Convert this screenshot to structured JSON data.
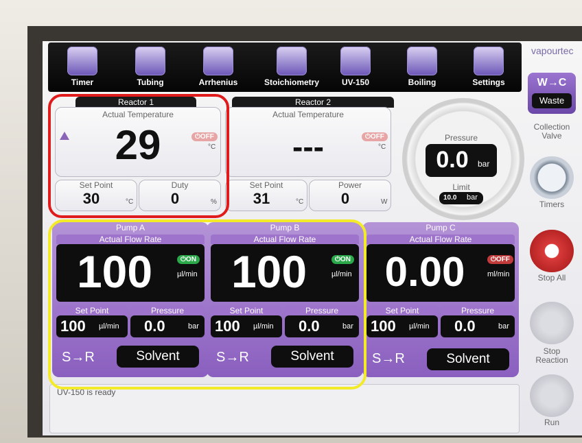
{
  "brand": "vapourtec",
  "toolbar": [
    "Timer",
    "Tubing",
    "Arrhenius",
    "Stoichiometry",
    "UV-150",
    "Boiling",
    "Settings"
  ],
  "reactor1": {
    "title": "Reactor 1",
    "label_actual": "Actual Temperature",
    "value": "29",
    "unit": "°C",
    "status": "OFF",
    "set_point_label": "Set Point",
    "set_point": "30",
    "set_unit": "°C",
    "duty_label": "Duty",
    "duty": "0",
    "duty_unit": "%"
  },
  "reactor2": {
    "title": "Reactor 2",
    "label_actual": "Actual Temperature",
    "value": "---",
    "unit": "°C",
    "status": "OFF",
    "set_point_label": "Set Point",
    "set_point": "31",
    "set_unit": "°C",
    "power_label": "Power",
    "power": "0",
    "power_unit": "W"
  },
  "pressure": {
    "label": "Pressure",
    "value": "0.0",
    "unit": "bar",
    "limit_label": "Limit",
    "limit": "10.0",
    "limit_unit": "bar"
  },
  "pumps": [
    {
      "title": "Pump A",
      "afr": "Actual Flow Rate",
      "value": "100",
      "unit": "µl/min",
      "status": "ON",
      "sp_label": "Set Point",
      "sp": "100",
      "sp_unit": "µl/min",
      "pr_label": "Pressure",
      "pr": "0.0",
      "pr_unit": "bar",
      "route": "S→R",
      "solvent": "Solvent"
    },
    {
      "title": "Pump B",
      "afr": "Actual Flow Rate",
      "value": "100",
      "unit": "µl/min",
      "status": "ON",
      "sp_label": "Set Point",
      "sp": "100",
      "sp_unit": "µl/min",
      "pr_label": "Pressure",
      "pr": "0.0",
      "pr_unit": "bar",
      "route": "S→R",
      "solvent": "Solvent"
    },
    {
      "title": "Pump C",
      "afr": "Actual Flow Rate",
      "value": "0.00",
      "unit": "ml/min",
      "status": "OFF",
      "sp_label": "Set Point",
      "sp": "100",
      "sp_unit": "µl/min",
      "pr_label": "Pressure",
      "pr": "0.0",
      "pr_unit": "bar",
      "route": "S→R",
      "solvent": "Solvent"
    }
  ],
  "right": {
    "valve_title": "W→C",
    "valve_state": "Waste",
    "collection_label": "Collection Valve",
    "timers_label": "Timers",
    "stop_all_label": "Stop All",
    "stop_reaction_label": "Stop Reaction",
    "run_label": "Run"
  },
  "status_text": "UV-150 is ready"
}
